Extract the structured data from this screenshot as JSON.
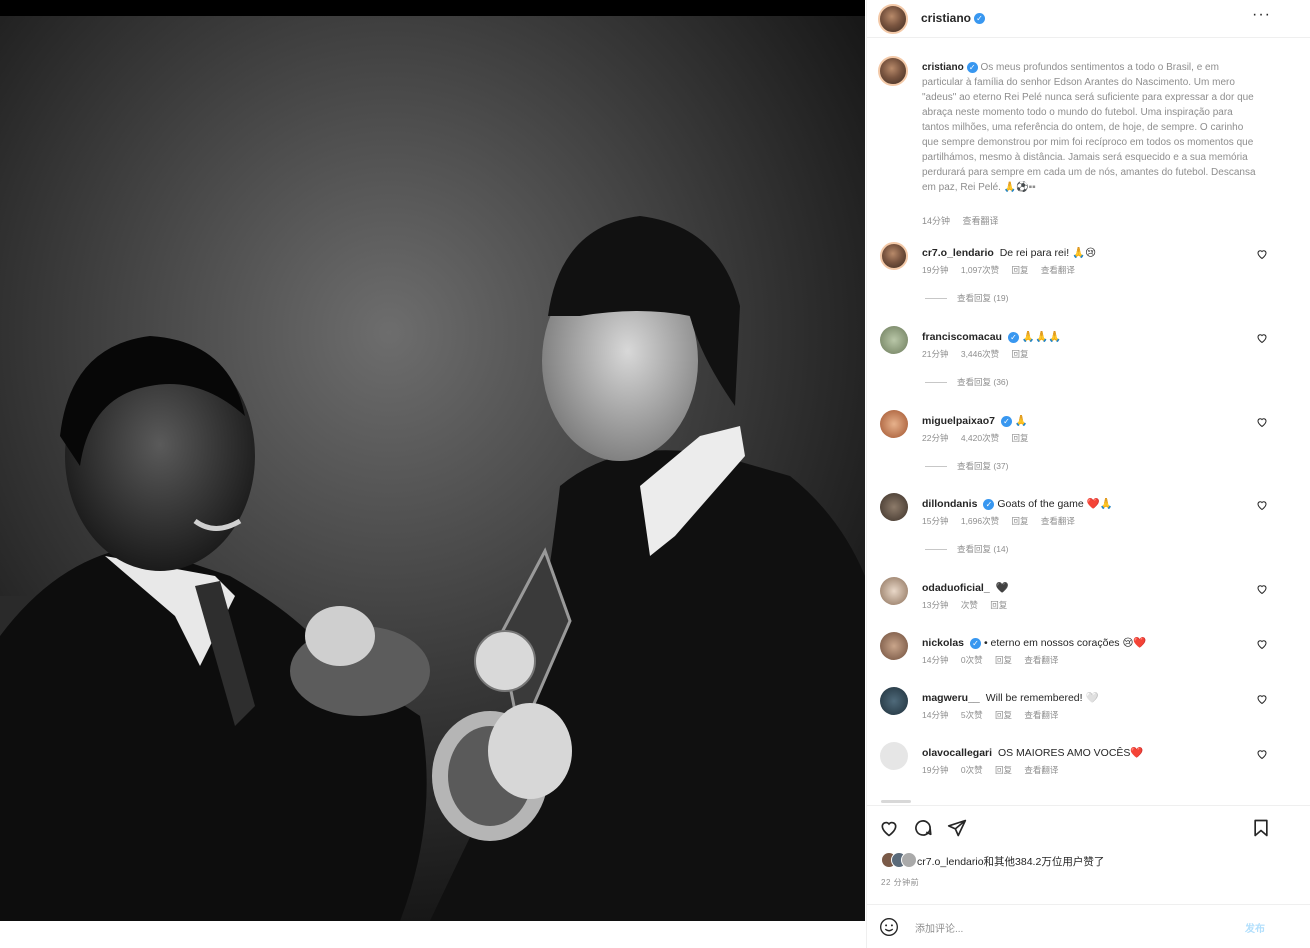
{
  "post": {
    "author": "cristiano",
    "caption": "Os meus profundos sentimentos a todo o Brasil, e em particular à família do senhor Edson Arantes do Nascimento. Um mero \"adeus\" ao eterno Rei Pelé nunca será suficiente para expressar a dor que abraça neste momento todo o mundo do futebol. Uma inspiração para tantos milhões, uma referência do ontem, de hoje, de sempre. O carinho que sempre demonstrou por mim foi recíproco em todos os momentos que partilhámos, mesmo à distância. Jamais será esquecido e a sua memória perdurará para sempre em cada um de nós, amantes do futebol. Descansa em paz, Rei Pelé. 🙏⚽▪▪",
    "caption_time": "14分钟",
    "caption_translate": "查看翻译"
  },
  "comments": [
    {
      "user": "cr7.o_lendario",
      "text": "De rei para rei! 🙏😢",
      "verified": false,
      "time": "19分钟",
      "likes": "1,097次赞",
      "reply": "回复",
      "translate": "查看翻译",
      "view_replies": "查看回复 (19)"
    },
    {
      "user": "franciscomacau",
      "text": "🙏🙏🙏",
      "verified": true,
      "time": "21分钟",
      "likes": "3,446次赞",
      "reply": "回复",
      "translate": "",
      "view_replies": "查看回复 (36)"
    },
    {
      "user": "miguelpaixao7",
      "text": "🙏",
      "verified": true,
      "time": "22分钟",
      "likes": "4,420次赞",
      "reply": "回复",
      "translate": "",
      "view_replies": "查看回复 (37)"
    },
    {
      "user": "dillondanis",
      "text": "Goats of the game ❤️🙏",
      "verified": true,
      "time": "15分钟",
      "likes": "1,696次赞",
      "reply": "回复",
      "translate": "查看翻译",
      "view_replies": "查看回复 (14)"
    },
    {
      "user": "odaduoficial_",
      "text": "🖤",
      "verified": false,
      "time": "13分钟",
      "likes": "次赞",
      "reply": "回复",
      "translate": "",
      "view_replies": ""
    },
    {
      "user": "nickolas",
      "text": "• eterno em nossos corações 😢❤️",
      "verified": true,
      "time": "14分钟",
      "likes": "0次赞",
      "reply": "回复",
      "translate": "查看翻译",
      "view_replies": ""
    },
    {
      "user": "magweru__",
      "text": "Will be remembered! 🤍",
      "verified": false,
      "time": "14分钟",
      "likes": "5次赞",
      "reply": "回复",
      "translate": "查看翻译",
      "view_replies": ""
    },
    {
      "user": "olavocallegari",
      "text": "OS MAIORES AMO VOCÊS❤️",
      "verified": false,
      "time": "19分钟",
      "likes": "0次赞",
      "reply": "回复",
      "translate": "查看翻译",
      "view_replies": ""
    }
  ],
  "liked_by": "cr7.o_lendario和其他384.2万位用户赞了",
  "liked_time": "22 分钟前",
  "add_comment_placeholder": "添加评论...",
  "post_button": "发布",
  "colors": {
    "verified": "#3897f0",
    "post_button": "#b2dffc",
    "meta_grey": "#8e8e8e"
  },
  "icons": [
    "more-icon",
    "heart-icon",
    "comment-icon",
    "share-icon",
    "bookmark-icon",
    "smile-icon"
  ]
}
